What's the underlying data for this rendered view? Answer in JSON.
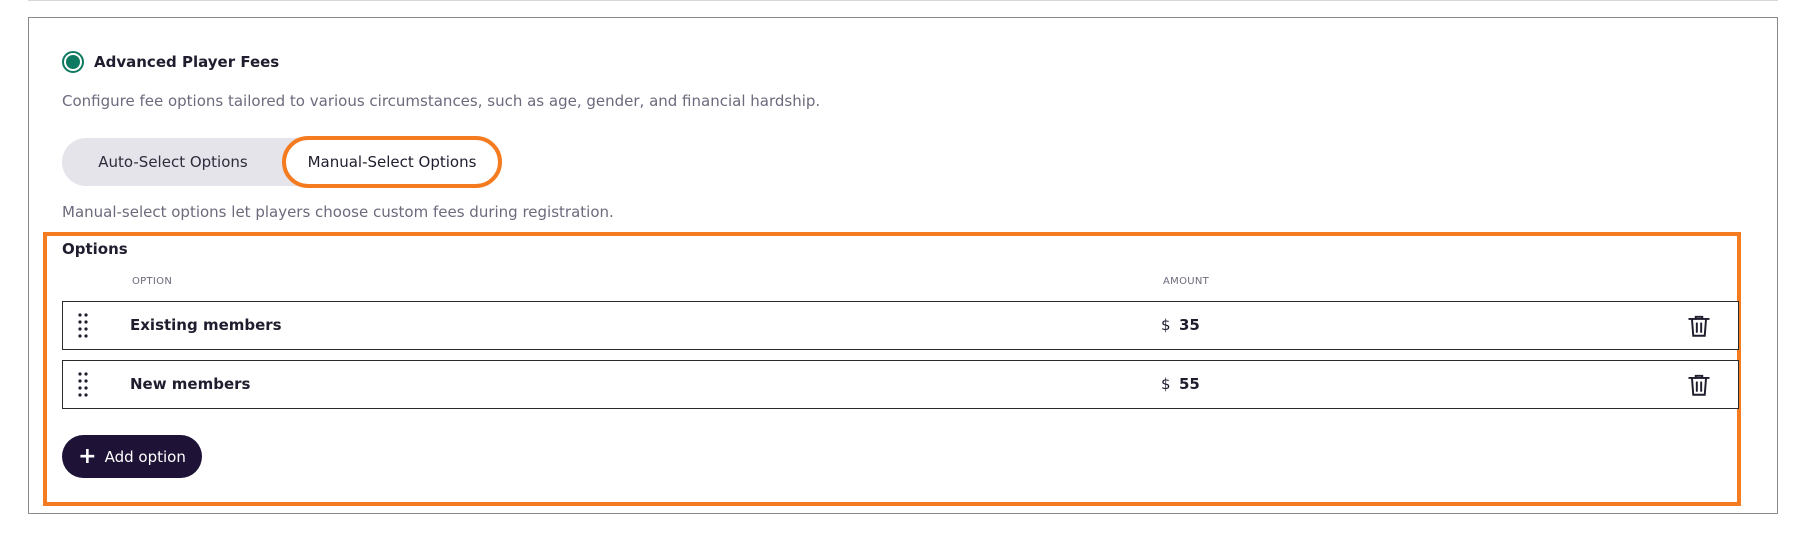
{
  "fees": {
    "section_label": "Advanced Player Fees",
    "description": "Configure fee options tailored to various circumstances, such as age, gender, and financial hardship.",
    "segment": {
      "auto_label": "Auto-Select Options",
      "manual_label": "Manual-Select Options",
      "selected": "manual"
    },
    "manual_description": "Manual-select options let players choose custom fees during registration."
  },
  "options": {
    "title": "Options",
    "column_option": "OPTION",
    "column_amount": "AMOUNT",
    "rows": [
      {
        "name": "Existing members",
        "currency": "$",
        "amount": "35"
      },
      {
        "name": "New members",
        "currency": "$",
        "amount": "55"
      }
    ],
    "add_label": "Add option"
  },
  "colors": {
    "accent": "#0f7a62",
    "highlight": "#f47b20",
    "button_bg": "#1e1236"
  },
  "icons": {
    "radio": "radio-selected-icon",
    "drag": "drag-handle-icon",
    "delete": "trash-icon",
    "add": "plus-icon"
  }
}
